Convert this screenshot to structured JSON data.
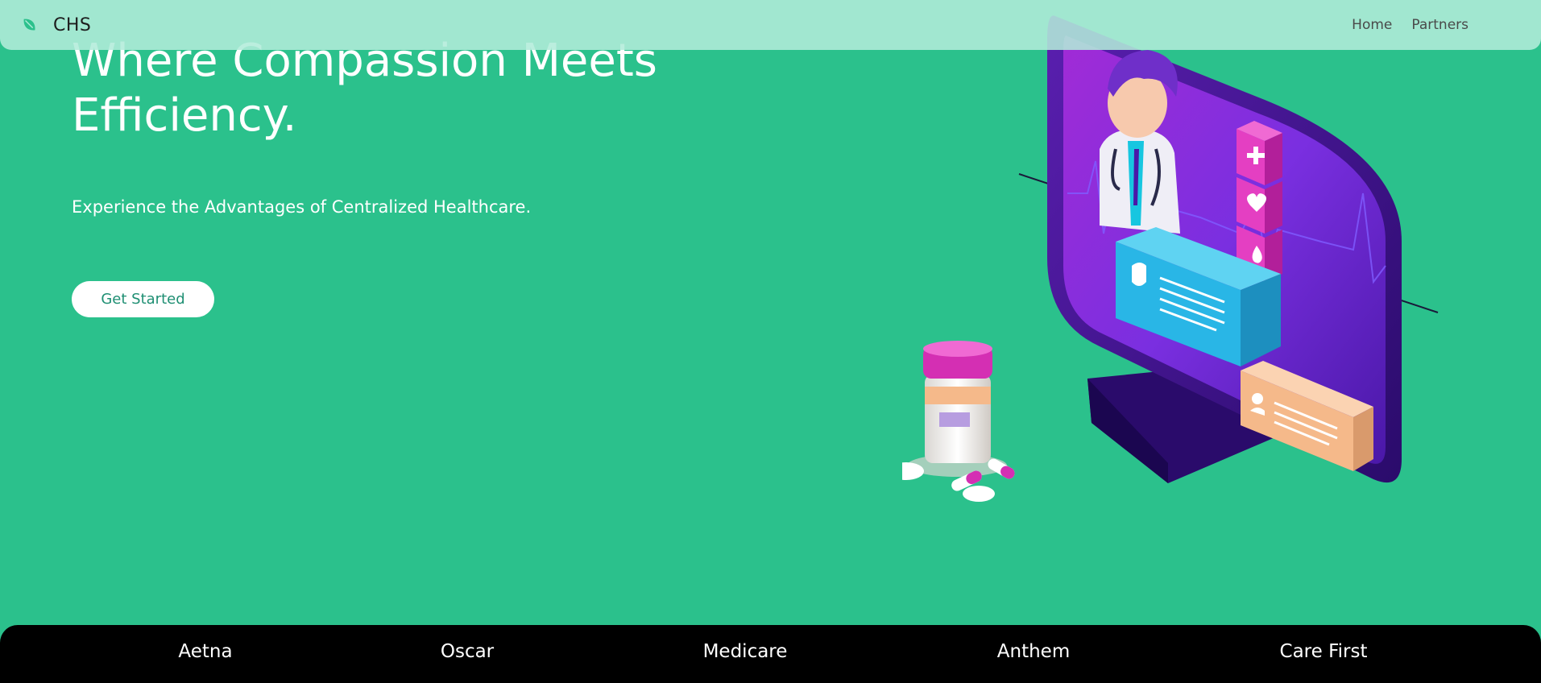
{
  "nav": {
    "brand": "CHS",
    "links": [
      "Home",
      "Partners"
    ]
  },
  "hero": {
    "title": "Where Compassion Meets Efficiency.",
    "subtitle": "Experience the Advantages of Centralized Healthcare.",
    "cta": "Get Started"
  },
  "partners": [
    "Aetna",
    "Oscar",
    "Medicare",
    "Anthem",
    "Care First"
  ],
  "colors": {
    "background": "#2bc18c",
    "navbar": "#b2ecda",
    "accent": "#1f8f73",
    "footer": "#000000"
  },
  "icons": [
    "leaf-icon",
    "telehealth-illustration"
  ]
}
